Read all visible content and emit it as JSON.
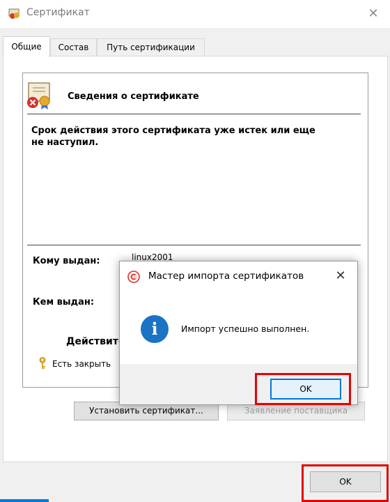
{
  "window": {
    "title": "Сертификат",
    "close_glyph": "✕",
    "tabs": [
      {
        "label": "Общие",
        "active": true
      },
      {
        "label": "Состав",
        "active": false
      },
      {
        "label": "Путь сертификации",
        "active": false
      }
    ]
  },
  "general": {
    "info_title": "Сведения о сертификате",
    "warning": "Срок действия этого сертификата уже истек или еще не наступил.",
    "issued_to_label": "Кому выдан:",
    "issued_to_value": "linux2001",
    "issued_by_label": "Кем выдан:",
    "validity_label": "Действите",
    "private_key_text": "Есть закрыть",
    "install_button": "Установить сертификат...",
    "issuer_statement_button": "Заявление поставщика"
  },
  "ok_button": "OK",
  "dialog": {
    "title": "Мастер импорта сертификатов",
    "close_glyph": "✕",
    "info_glyph": "i",
    "message": "Импорт успешно выполнен.",
    "ok_button": "OK"
  },
  "colors": {
    "highlight": "#e50000",
    "info_blue": "#1a73c4",
    "focus_blue": "#0078d7"
  },
  "icons": [
    "certificate-icon",
    "certificate-error-icon",
    "key-icon",
    "app-icon",
    "info-icon",
    "close-icon"
  ]
}
